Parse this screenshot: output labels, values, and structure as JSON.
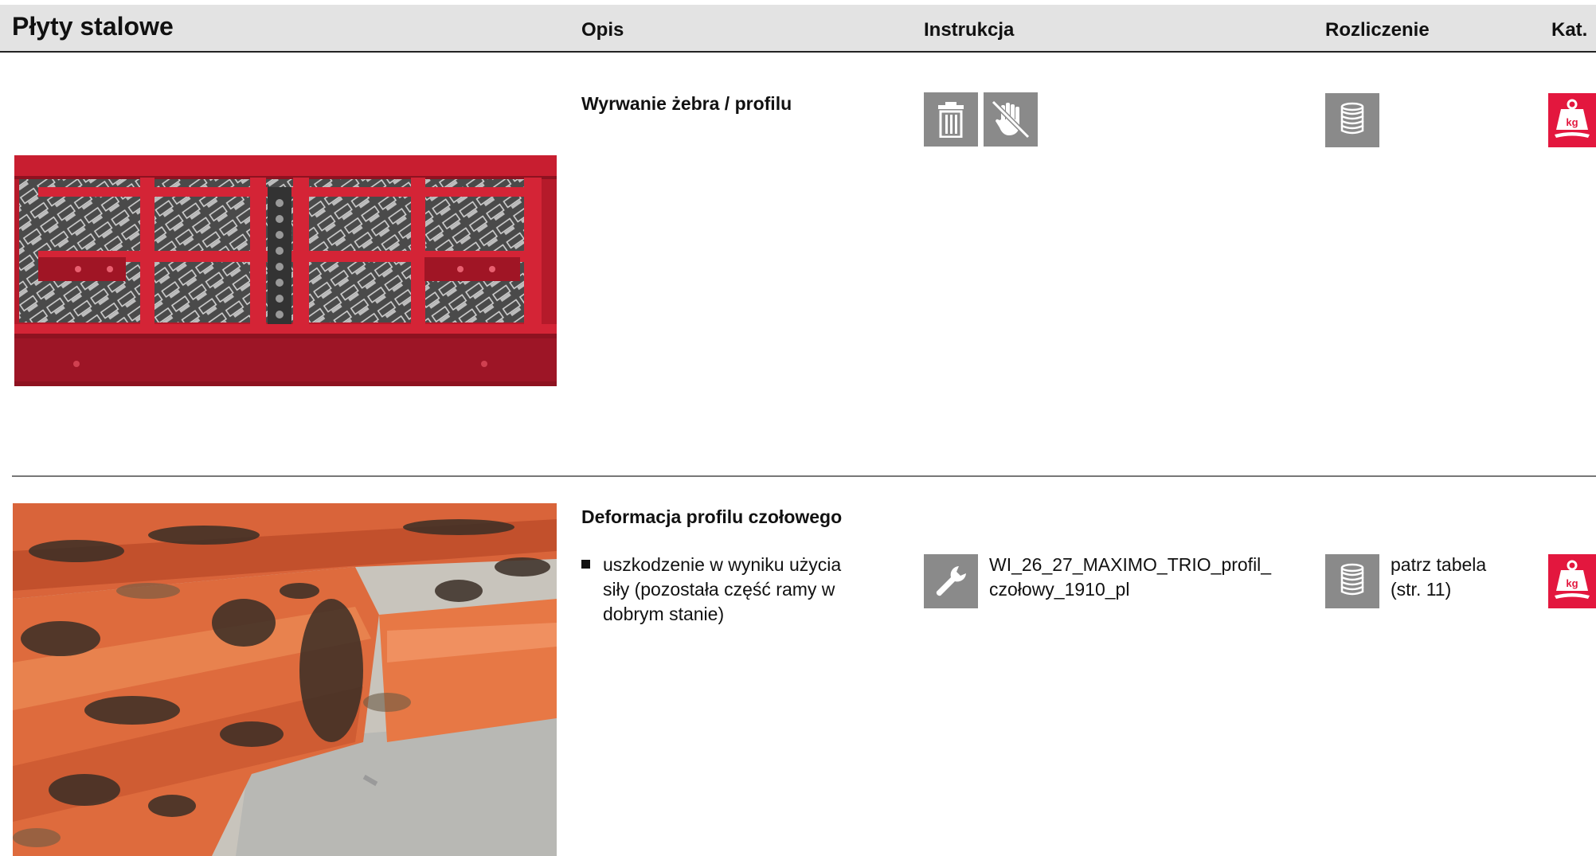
{
  "header": {
    "title": "Płyty stalowe",
    "columns": {
      "opis": "Opis",
      "instrukcja": "Instrukcja",
      "rozliczenie": "Rozliczenie",
      "kat": "Kat."
    }
  },
  "rows": [
    {
      "title": "Wyrwanie żebra / profilu",
      "photo": "red steel panel with plywood-patterned facing",
      "instruction_icons": [
        "trash-icon",
        "no-repair-hand-icon"
      ],
      "billing_icon": "coin-stack-icon",
      "category_icon": "weight-kg-icon"
    },
    {
      "title": "Deformacja profilu czołowego",
      "bullet": "uszkodzenie w wyniku użycia siły (pozostała część ramy w dobrym stanie)",
      "photo": "close-up of rusty orange steel frame profile",
      "instruction_icon": "wrench-icon",
      "instruction_doc": "WI_26_27_MAXIMO_TRIO_profil_ czołowy_1910_pl",
      "billing_icon": "coin-stack-icon",
      "billing_text": "patrz tabela (str. 11)",
      "category_icon": "weight-kg-icon"
    }
  ],
  "colors": {
    "header_bg": "#e3e3e3",
    "icon_grey": "#8a8a8a",
    "category_red": "#e3173e",
    "panel_red": "#c81e30"
  }
}
